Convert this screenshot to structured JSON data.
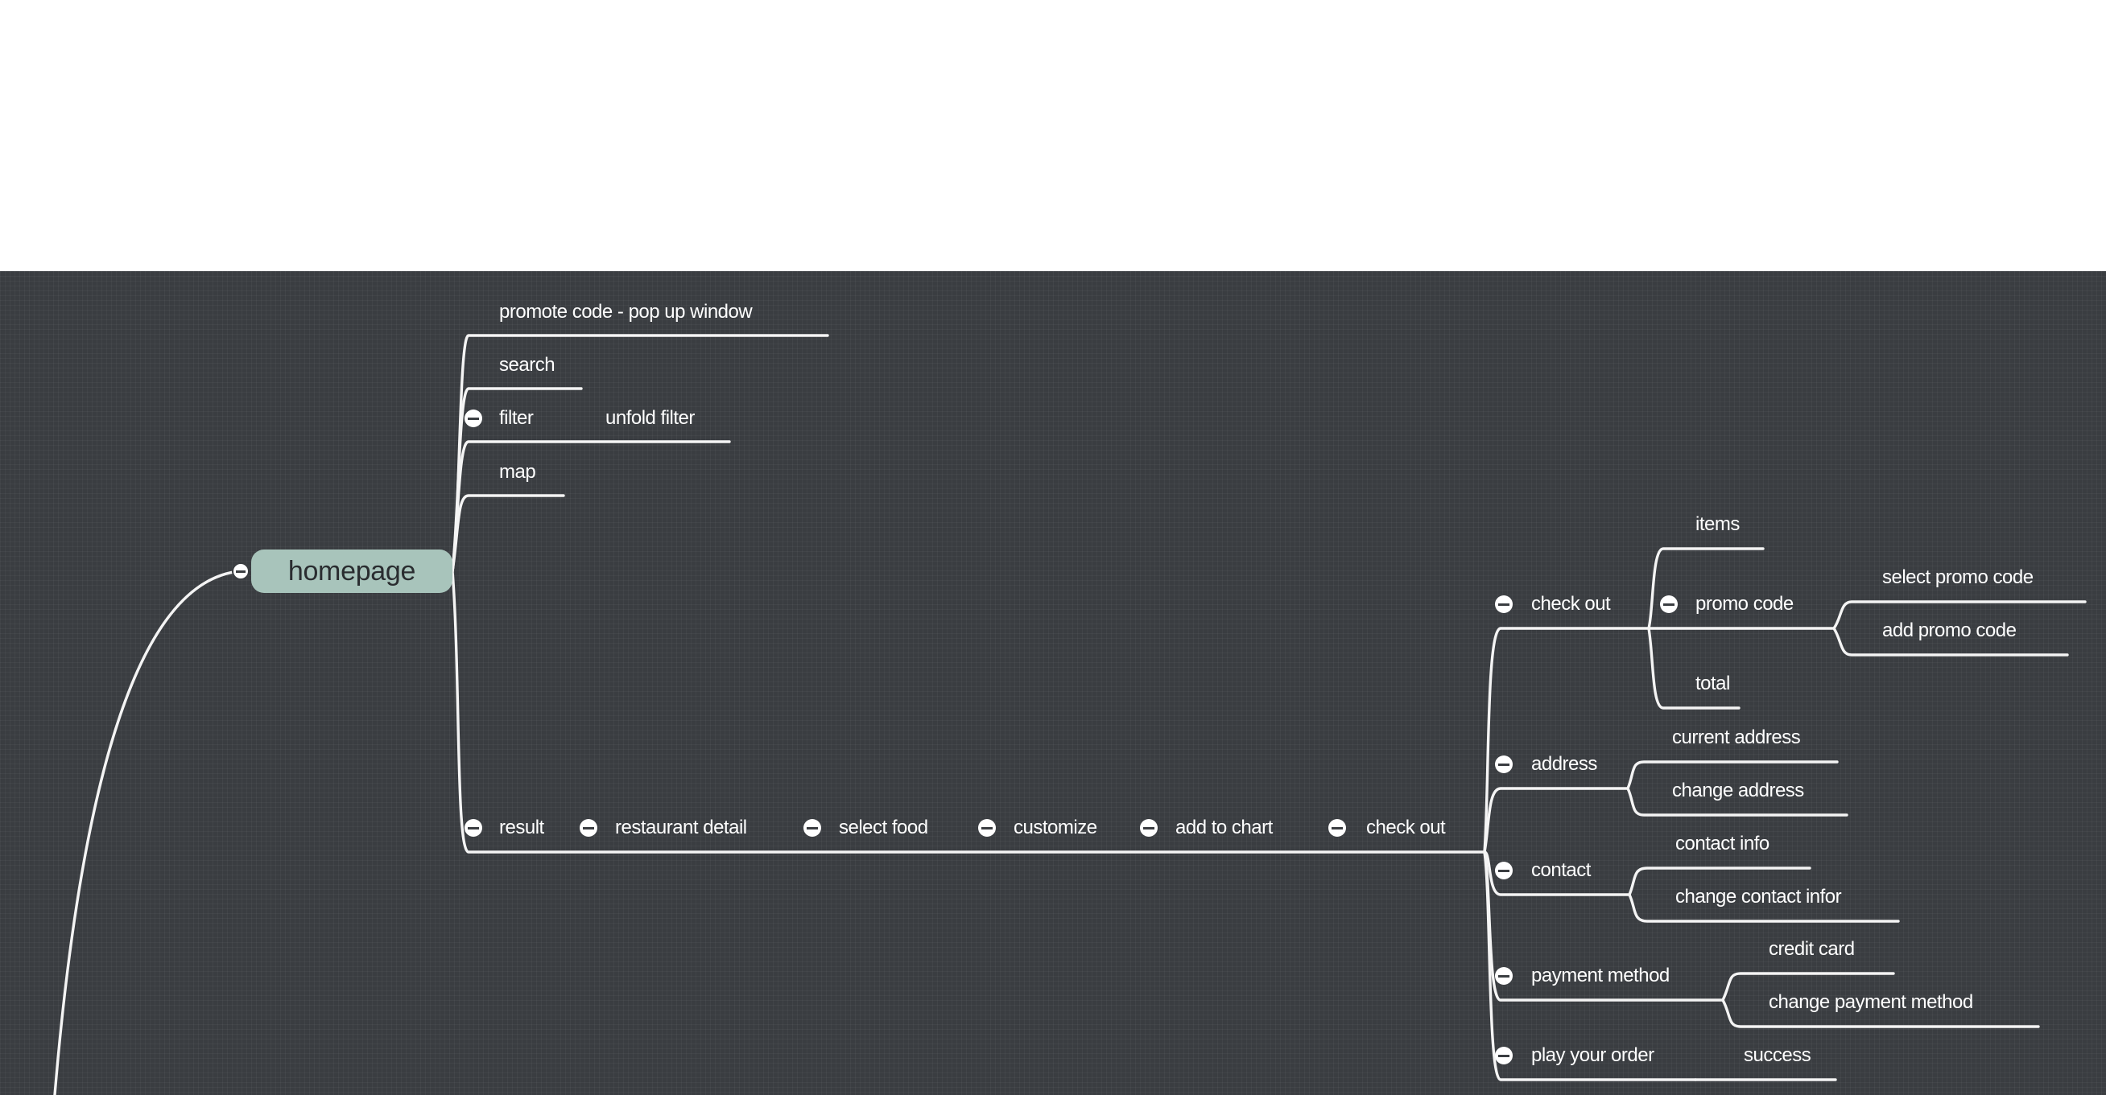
{
  "root": {
    "label": "homepage"
  },
  "top_branch": {
    "promote": "promote code - pop up window",
    "search": "search",
    "filter": "filter",
    "unfold_filter": "unfold filter",
    "map": "map"
  },
  "flow": {
    "result": "result",
    "restaurant_detail": "restaurant detail",
    "select_food": "select food",
    "customize": "customize",
    "add_to_chart": "add to chart",
    "check_out": "check out"
  },
  "checkout_branch": {
    "check_out": "check out",
    "items": "items",
    "promo_code": "promo code",
    "select_promo_code": "select promo code",
    "add_promo_code": "add promo code",
    "total": "total",
    "address": "address",
    "current_address": "current address",
    "change_address": "change address",
    "contact": "contact",
    "contact_info": "contact info",
    "change_contact_infor": "change contact infor",
    "payment_method": "payment method",
    "credit_card": "credit card",
    "change_payment_method": "change payment method",
    "play_your_order": "play your order",
    "success": "success"
  },
  "colors": {
    "canvas": "#3a3d41",
    "line": "#f4f4f4",
    "root_fill": "#a8c4bb",
    "text": "#ffffff"
  },
  "icons": {
    "collapse": "minus-circle-icon"
  }
}
